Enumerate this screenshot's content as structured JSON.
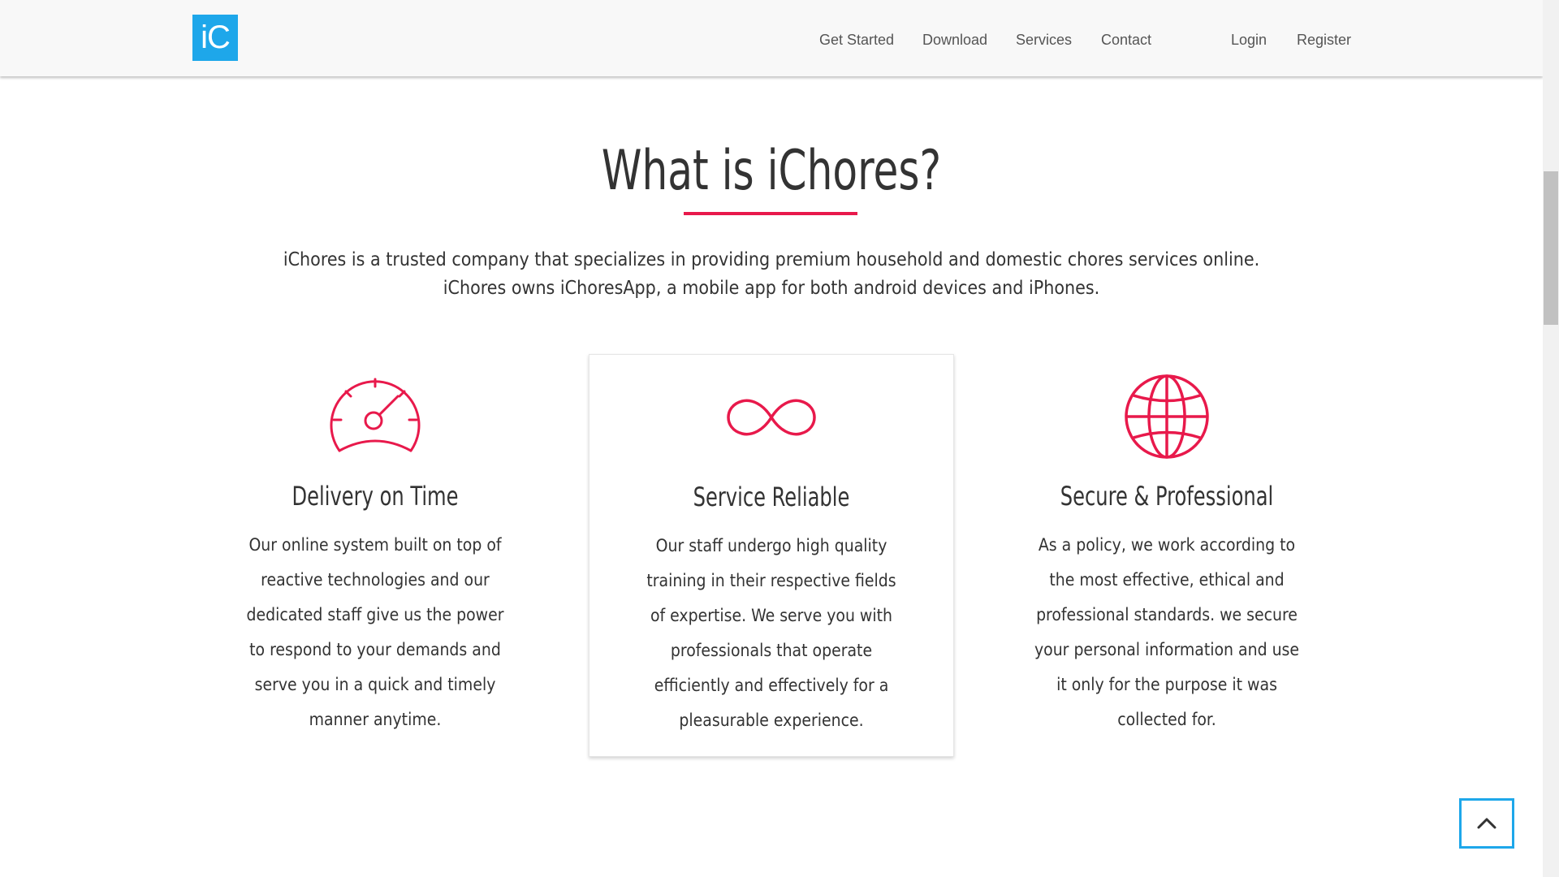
{
  "colors": {
    "brand": "#1ea7ea",
    "accent": "#e8194b",
    "text": "#333333",
    "nav_text": "#555555"
  },
  "navbar": {
    "logo_text": "iC",
    "links": [
      {
        "label": "Get Started"
      },
      {
        "label": "Download"
      },
      {
        "label": "Services"
      },
      {
        "label": "Contact"
      }
    ],
    "auth": {
      "login": "Login",
      "register": "Register"
    }
  },
  "main": {
    "title": "What is iChores?",
    "intro_line_1": "iChores is a trusted company that specializes in providing premium household and domestic chores services online.",
    "intro_line_2": "iChores owns iChoresApp, a mobile app for both android devices and iPhones.",
    "features": [
      {
        "icon": "speedometer-icon",
        "title": "Delivery on Time",
        "description": "Our online system built on top of reactive technologies and our dedicated staff give us the power to respond to your demands and serve you in a quick and timely manner anytime."
      },
      {
        "icon": "infinity-icon",
        "title": "Service Reliable",
        "description": "Our staff undergo high quality training in their respective fields of expertise. We serve you with professionals that operate efficiently and effectively for a pleasurable experience."
      },
      {
        "icon": "globe-icon",
        "title": "Secure & Professional",
        "description": "As a policy, we work according to the most effective, ethical and professional standards. we secure your personal information and use it only for the purpose it was collected for."
      }
    ]
  },
  "back_to_top": {
    "icon": "chevron-up-icon"
  }
}
